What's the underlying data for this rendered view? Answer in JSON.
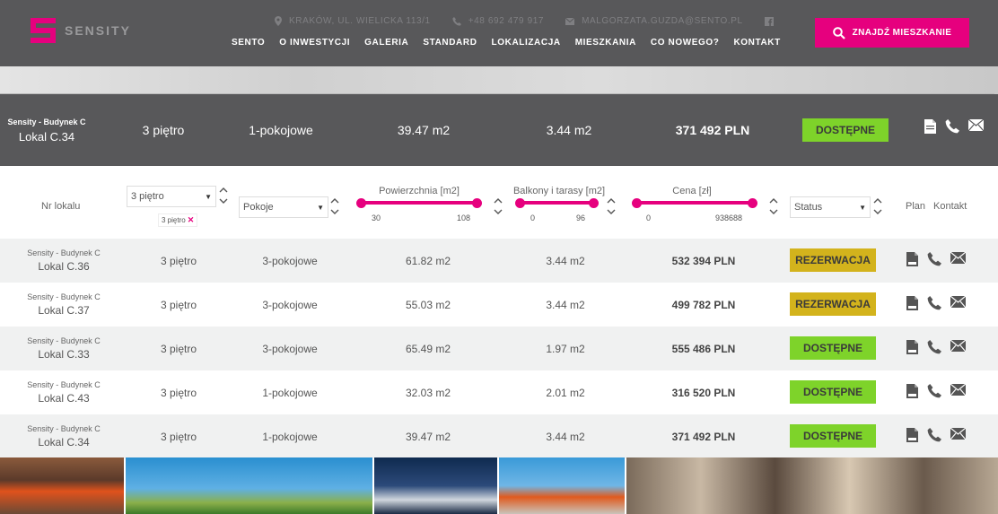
{
  "header": {
    "logo_text": "SENSITY",
    "address": "KRAKÓW, UL. WIELICKA 113/1",
    "phone": "+48 692 479 917",
    "email": "MALGORZATA.GUZDA@SENTO.PL",
    "nav": [
      "SENTO",
      "O INWESTYCJI",
      "GALERIA",
      "STANDARD",
      "LOKALIZACJA",
      "MIESZKANIA",
      "CO NOWEGO?",
      "KONTAKT"
    ],
    "find_button": "ZNAJDŹ MIESZKANIE"
  },
  "selected": {
    "building": "Sensity - Budynek C",
    "lokal": "Lokal C.34",
    "floor": "3 piętro",
    "rooms": "1-pokojowe",
    "area": "39.47 m2",
    "balcony": "3.44 m2",
    "price": "371 492 PLN",
    "status": "DOSTĘPNE"
  },
  "filters": {
    "nr_lokalu_label": "Nr lokalu",
    "floor_select": "3 piętro",
    "floor_tag": "3 piętro",
    "rooms_select": "Pokoje",
    "area_label": "Powierzchnia [m2]",
    "area_min": "30",
    "area_max": "108",
    "balcony_label": "Balkony i tarasy [m2]",
    "balcony_min": "0",
    "balcony_max": "96",
    "price_label": "Cena  [zł]",
    "price_min": "0",
    "price_max": "938688",
    "status_select": "Status",
    "plan_label": "Plan",
    "kontakt_label": "Kontakt"
  },
  "rows": [
    {
      "building": "Sensity - Budynek C",
      "lokal": "Lokal C.36",
      "floor": "3 piętro",
      "rooms": "3-pokojowe",
      "area": "61.82 m2",
      "balcony": "3.44 m2",
      "price": "532 394 PLN",
      "status": "REZERWACJA"
    },
    {
      "building": "Sensity - Budynek C",
      "lokal": "Lokal C.37",
      "floor": "3 piętro",
      "rooms": "3-pokojowe",
      "area": "55.03 m2",
      "balcony": "3.44 m2",
      "price": "499 782 PLN",
      "status": "REZERWACJA"
    },
    {
      "building": "Sensity - Budynek C",
      "lokal": "Lokal C.33",
      "floor": "3 piętro",
      "rooms": "3-pokojowe",
      "area": "65.49 m2",
      "balcony": "1.97 m2",
      "price": "555 486 PLN",
      "status": "DOSTĘPNE"
    },
    {
      "building": "Sensity - Budynek C",
      "lokal": "Lokal C.43",
      "floor": "3 piętro",
      "rooms": "1-pokojowe",
      "area": "32.03 m2",
      "balcony": "2.01 m2",
      "price": "316 520 PLN",
      "status": "DOSTĘPNE"
    },
    {
      "building": "Sensity - Budynek C",
      "lokal": "Lokal C.34",
      "floor": "3 piętro",
      "rooms": "1-pokojowe",
      "area": "39.47 m2",
      "balcony": "3.44 m2",
      "price": "371 492 PLN",
      "status": "DOSTĘPNE"
    }
  ],
  "colors": {
    "brand_pink": "#e6007e",
    "header_gray": "#58585a",
    "available_green": "#7ed32a",
    "reserved_gold": "#d3b31c"
  },
  "icons": [
    "map-pin-icon",
    "phone-icon",
    "mail-icon",
    "facebook-icon",
    "search-icon",
    "pdf-file-icon",
    "phone-icon",
    "envelope-icon"
  ]
}
